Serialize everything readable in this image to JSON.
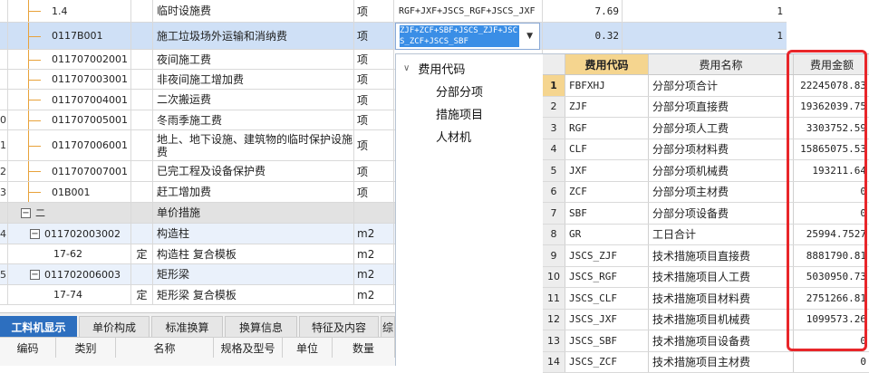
{
  "grid_rows": [
    {
      "code": "1.4",
      "type": "",
      "name": "临时设施费",
      "unit": "项",
      "expr": "RGF+JXF+JSCS_RGF+JSCS_JXF",
      "rate": "7.69",
      "qty": "1",
      "idx": ""
    },
    {
      "code": "0117B001",
      "type": "",
      "name": "施工垃圾场外运输和消纳费",
      "unit": "项",
      "expr": "",
      "rate": "0.32",
      "qty": "1",
      "idx": ""
    },
    {
      "code": "011707002001",
      "type": "",
      "name": "夜间施工费",
      "unit": "项",
      "expr": "",
      "rate": "",
      "qty": "",
      "idx": ""
    },
    {
      "code": "011707003001",
      "type": "",
      "name": "非夜间施工增加费",
      "unit": "项",
      "expr": "",
      "rate": "",
      "qty": "",
      "idx": ""
    },
    {
      "code": "011707004001",
      "type": "",
      "name": "二次搬运费",
      "unit": "项",
      "expr": "",
      "rate": "",
      "qty": "",
      "idx": ""
    },
    {
      "code": "011707005001",
      "type": "",
      "name": "冬雨季施工费",
      "unit": "项",
      "expr": "",
      "rate": "",
      "qty": "",
      "idx": "0"
    },
    {
      "code": "011707006001",
      "type": "",
      "name": "地上、地下设施、建筑物的临时保护设施费",
      "unit": "项",
      "expr": "",
      "rate": "",
      "qty": "",
      "idx": "1"
    },
    {
      "code": "011707007001",
      "type": "",
      "name": "已完工程及设备保护费",
      "unit": "项",
      "expr": "",
      "rate": "",
      "qty": "",
      "idx": "2"
    },
    {
      "code": "01B001",
      "type": "",
      "name": "赶工增加费",
      "unit": "项",
      "expr": "",
      "rate": "",
      "qty": "",
      "idx": "3"
    },
    {
      "code": "二",
      "type": "",
      "name": "单价措施",
      "unit": "",
      "expr": "",
      "rate": "",
      "qty": "",
      "idx": ""
    },
    {
      "code": "011702003002",
      "type": "",
      "name": "构造柱",
      "unit": "m2",
      "expr": "",
      "rate": "",
      "qty": "",
      "idx": "4"
    },
    {
      "code": "17-62",
      "type": "定",
      "name": "构造柱 复合模板",
      "unit": "m2",
      "expr": "",
      "rate": "",
      "qty": "",
      "idx": ""
    },
    {
      "code": "011702006003",
      "type": "",
      "name": "矩形梁",
      "unit": "m2",
      "expr": "",
      "rate": "",
      "qty": "",
      "idx": "5"
    },
    {
      "code": "17-74",
      "type": "定",
      "name": "矩形梁 复合模板",
      "unit": "m2",
      "expr": "",
      "rate": "",
      "qty": "",
      "idx": ""
    }
  ],
  "editor": {
    "value": "ZJF+ZCF+SBF+JSCS_ZJF+JSCS_ZCF+JSCS_SBF",
    "arrow": "▼"
  },
  "tree": {
    "root": "费用代码",
    "root_chev": "∨",
    "items": [
      "分部分项",
      "措施项目",
      "人材机"
    ]
  },
  "fee_table": {
    "headers": {
      "code": "费用代码",
      "name": "费用名称",
      "amount": "费用金额"
    },
    "rows": [
      {
        "idx": "1",
        "code": "FBFXHJ",
        "name": "分部分项合计",
        "amount": "22245078.83"
      },
      {
        "idx": "2",
        "code": "ZJF",
        "name": "分部分项直接费",
        "amount": "19362039.75"
      },
      {
        "idx": "3",
        "code": "RGF",
        "name": "分部分项人工费",
        "amount": "3303752.59"
      },
      {
        "idx": "4",
        "code": "CLF",
        "name": "分部分项材料费",
        "amount": "15865075.53"
      },
      {
        "idx": "5",
        "code": "JXF",
        "name": "分部分项机械费",
        "amount": "193211.64"
      },
      {
        "idx": "6",
        "code": "ZCF",
        "name": "分部分项主材费",
        "amount": "0"
      },
      {
        "idx": "7",
        "code": "SBF",
        "name": "分部分项设备费",
        "amount": "0"
      },
      {
        "idx": "8",
        "code": "GR",
        "name": "工日合计",
        "amount": "25994.7527"
      },
      {
        "idx": "9",
        "code": "JSCS_ZJF",
        "name": "技术措施项目直接费",
        "amount": "8881790.81"
      },
      {
        "idx": "10",
        "code": "JSCS_RGF",
        "name": "技术措施项目人工费",
        "amount": "5030950.73"
      },
      {
        "idx": "11",
        "code": "JSCS_CLF",
        "name": "技术措施项目材料费",
        "amount": "2751266.81"
      },
      {
        "idx": "12",
        "code": "JSCS_JXF",
        "name": "技术措施项目机械费",
        "amount": "1099573.26"
      },
      {
        "idx": "13",
        "code": "JSCS_SBF",
        "name": "技术措施项目设备费",
        "amount": "0"
      },
      {
        "idx": "14",
        "code": "JSCS_ZCF",
        "name": "技术措施项目主材费",
        "amount": "0"
      }
    ]
  },
  "bottom_tabs": [
    "工料机显示",
    "单价构成",
    "标准换算",
    "换算信息",
    "特征及内容",
    "综"
  ],
  "bottom_headers": [
    "编码",
    "类别",
    "名称",
    "规格及型号",
    "单位",
    "数量"
  ],
  "colors": {
    "highlight": "#e8262a",
    "selected_row": "#cfe0f6",
    "active_tab": "#2d6fbf",
    "header_accent": "#f5d58f"
  }
}
